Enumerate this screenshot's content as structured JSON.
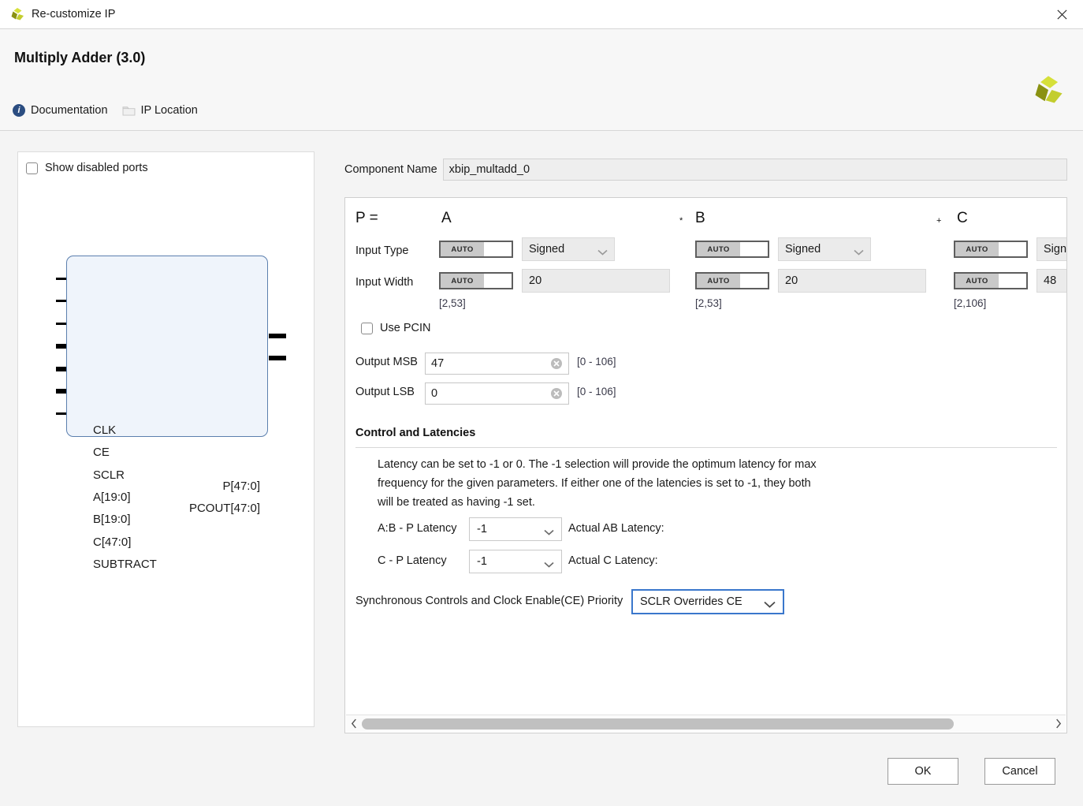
{
  "window": {
    "title": "Re-customize IP",
    "close_label": "close-icon"
  },
  "header": {
    "ip_title": "Multiply Adder (3.0)",
    "links": [
      {
        "label": "Documentation",
        "icon": "info-icon"
      },
      {
        "label": "IP Location",
        "icon": "folder-icon"
      }
    ]
  },
  "preview": {
    "show_disabled_ports": "Show disabled ports",
    "checked": false,
    "inputs": [
      "CLK",
      "CE",
      "SCLR",
      "A[19:0]",
      "B[19:0]",
      "C[47:0]",
      "SUBTRACT"
    ],
    "outputs": [
      "P[47:0]",
      "PCOUT[47:0]"
    ]
  },
  "component": {
    "label": "Component Name",
    "value": "xbip_multadd_0"
  },
  "equation": {
    "result": "P =",
    "operand_a": "A",
    "op1": "*",
    "operand_b": "B",
    "op2": "+",
    "operand_c": "C"
  },
  "rows": {
    "input_type": "Input Type",
    "input_width": "Input Width"
  },
  "columns": [
    {
      "name": "A",
      "type_auto": "AUTO",
      "type_value": "Signed",
      "width_auto": "AUTO",
      "width_value": "20",
      "width_range": "[2,53]"
    },
    {
      "name": "B",
      "type_auto": "AUTO",
      "type_value": "Signed",
      "width_auto": "AUTO",
      "width_value": "20",
      "width_range": "[2,53]"
    },
    {
      "name": "C",
      "type_auto": "AUTO",
      "type_value": "Sign",
      "width_auto": "AUTO",
      "width_value": "48",
      "width_range": "[2,106]"
    }
  ],
  "pcin": {
    "label": "Use PCIN",
    "checked": false
  },
  "output": {
    "msb_label": "Output MSB",
    "msb_value": "47",
    "msb_range": "[0 - 106]",
    "lsb_label": "Output LSB",
    "lsb_value": "0",
    "lsb_range": "[0 - 106]"
  },
  "control": {
    "section_title": "Control and Latencies",
    "description": "Latency can be set to -1 or 0. The -1 selection will provide the optimum latency for max frequency for the given parameters. If either one of the latencies is set to -1, they both will be treated as having -1 set.",
    "ab_latency_label": "A:B - P Latency",
    "ab_latency_value": "-1",
    "actual_ab_label": "Actual AB Latency:",
    "actual_ab_value": "",
    "c_latency_label": "C - P Latency",
    "c_latency_value": "-1",
    "actual_c_label": "Actual C Latency:",
    "actual_c_value": "",
    "sync_label": "Synchronous Controls and Clock Enable(CE) Priority",
    "sync_value": "SCLR Overrides CE"
  },
  "footer": {
    "ok": "OK",
    "cancel": "Cancel"
  },
  "colors": {
    "accent_focus": "#3a77cc",
    "symbol_fill": "#eff4fb",
    "symbol_border": "#5b7fae",
    "logo_light": "#d6e03a",
    "logo_mid": "#b8c32a",
    "logo_dark": "#8a9212",
    "info_badge": "#2b4d81"
  }
}
